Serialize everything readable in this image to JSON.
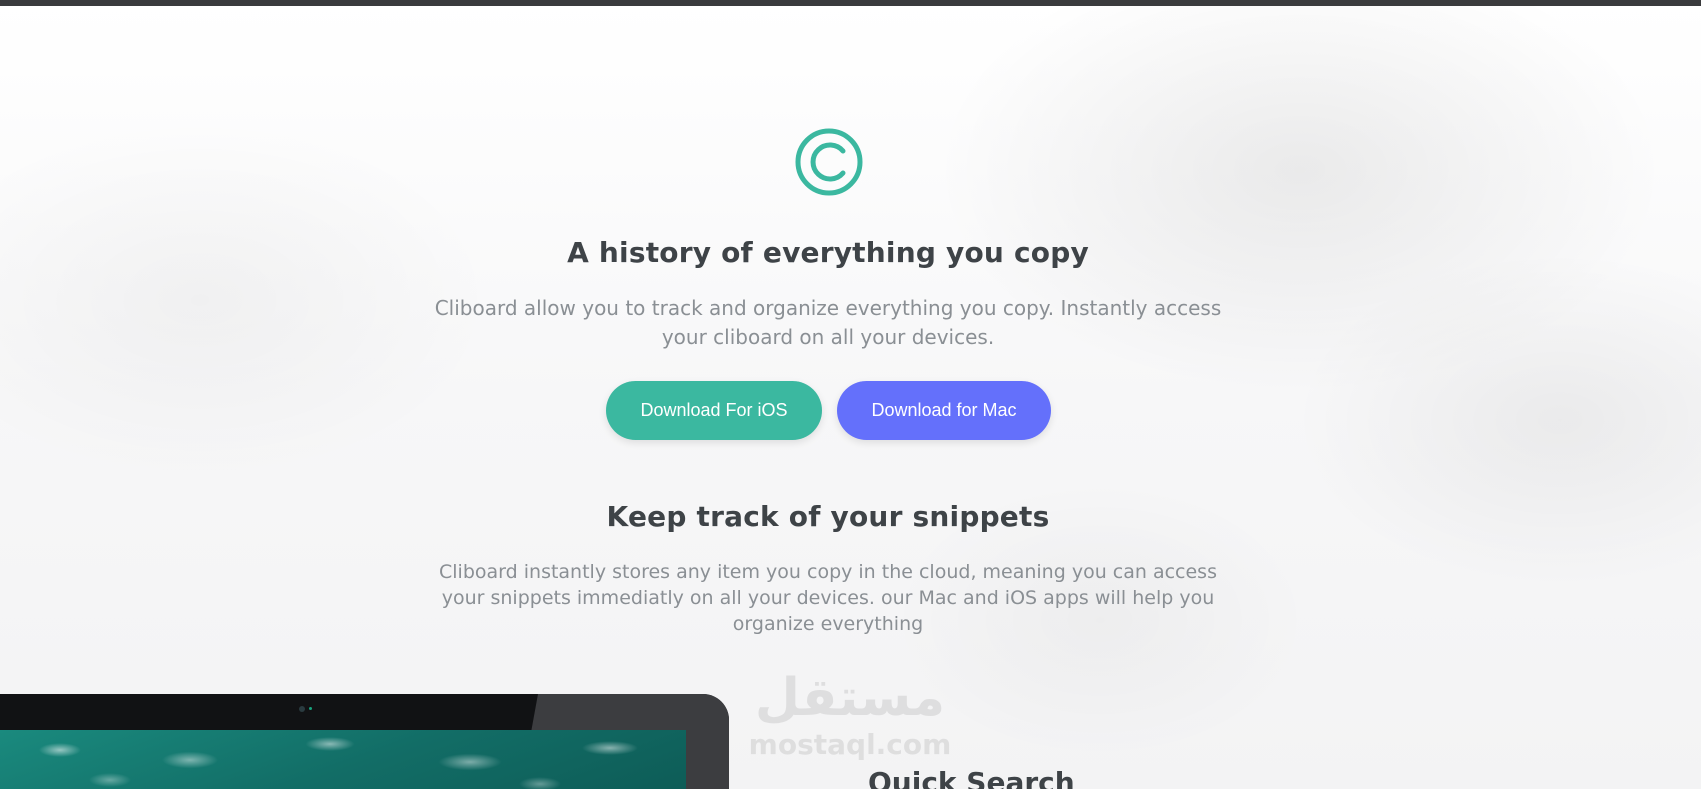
{
  "hero": {
    "logo_icon": "copyright-c-icon",
    "accent_color": "#3bb8a0",
    "title": "A history of everything you copy",
    "description": "Cliboard allow you to track and organize everything you copy. Instantly access your cliboard on all your devices.",
    "buttons": {
      "ios_label": "Download For iOS",
      "ios_color": "#3bb8a0",
      "mac_label": "Download for Mac",
      "mac_color": "#6470fb"
    }
  },
  "snippets": {
    "title": "Keep track of your snippets",
    "description": "Cliboard instantly stores any item you copy in the cloud, meaning you can access your snippets immediatly on all your devices. our Mac and iOS apps will help you organize everything"
  },
  "features": {
    "quick_search_title": "Quick Search"
  },
  "watermark": {
    "arabic_text": "مستقل",
    "latin_text": "mostaql.com"
  }
}
